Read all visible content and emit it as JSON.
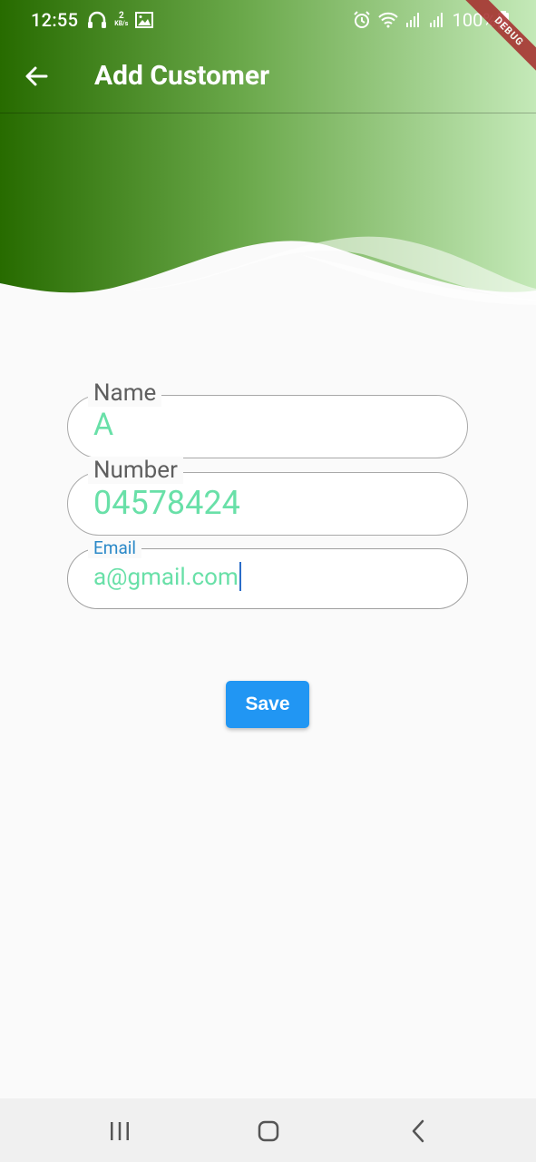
{
  "status_bar": {
    "time": "12:55",
    "speed_value": "2",
    "speed_unit": "KB/s",
    "battery": "100%"
  },
  "debug_banner": "DEBUG",
  "app_bar": {
    "title": "Add Customer",
    "back_icon": "arrow-left-icon"
  },
  "form": {
    "name": {
      "label": "Name",
      "value": "A"
    },
    "number": {
      "label": "Number",
      "value": "04578424"
    },
    "email": {
      "label": "Email",
      "value": "a@gmail.com"
    }
  },
  "save_button": {
    "label": "Save"
  },
  "colors": {
    "header_dark": "#2a6b00",
    "header_light": "#bde6b0",
    "input_text": "#69e0a8",
    "focused_label": "#2b89c8",
    "button": "#2196f3",
    "background": "#fafafa"
  },
  "nav": {
    "recent_icon": "recent-apps-icon",
    "home_icon": "home-icon",
    "back_icon": "back-icon"
  }
}
